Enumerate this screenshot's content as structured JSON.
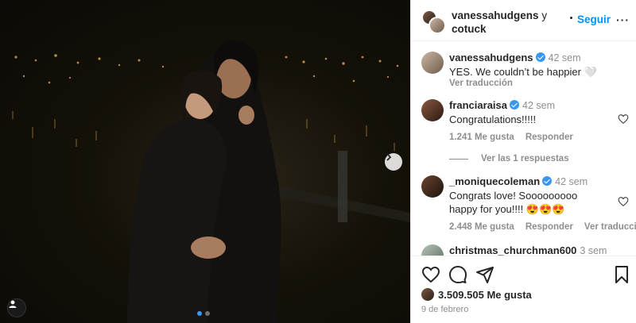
{
  "header": {
    "user1": "vanessahudgens",
    "connector": "y",
    "user2": "cotuck",
    "follow_label": "Seguir",
    "more_label": "···"
  },
  "caption": {
    "username": "vanessahudgens",
    "time": "42 sem",
    "text": "YES. We couldn’t be happier 🤍",
    "translate": "Ver traducción"
  },
  "comments": [
    {
      "username": "franciaraisa",
      "time": "42 sem",
      "text": "Congratulations!!!!!",
      "likes": "1.241 Me gusta",
      "reply": "Responder"
    },
    {
      "username": "_moniquecoleman",
      "time": "42 sem",
      "text": "Congrats love! Sooooooooo happy for you!!!! 😍😍😍",
      "likes": "2.448 Me gusta",
      "reply": "Responder",
      "translate": "Ver traducción"
    },
    {
      "username": "christmas_churchman600",
      "time": "3 sem"
    }
  ],
  "replies_label": "Ver las 1 respuestas",
  "footer": {
    "likes": "3.509.505 Me gusta",
    "date": "9 de febrero"
  },
  "colors": {
    "accent": "#0095f6",
    "verified": "#3897f0",
    "muted": "#8e8e8e"
  },
  "icons": [
    "heart-icon",
    "comment-icon",
    "share-icon",
    "bookmark-icon",
    "next-arrow-icon",
    "user-tag-icon",
    "verified-icon",
    "more-icon"
  ]
}
